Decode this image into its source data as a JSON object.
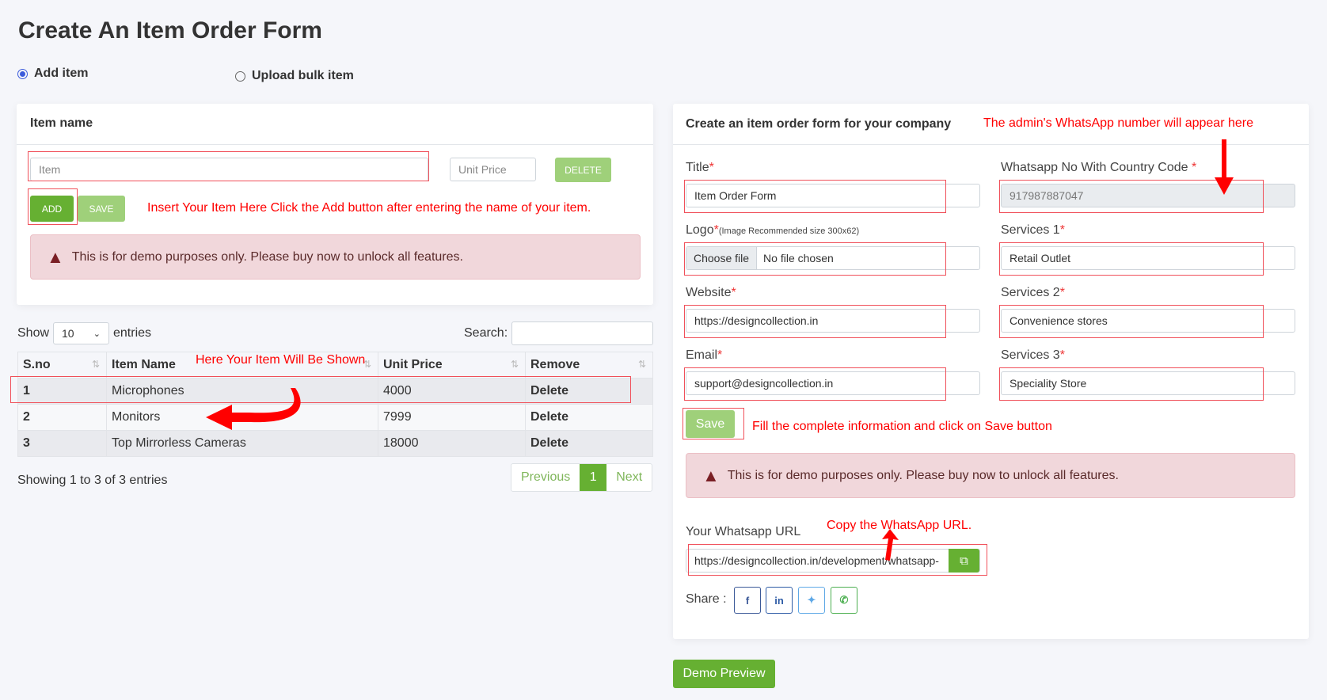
{
  "page": {
    "title": "Create An Item Order Form"
  },
  "mode": {
    "add_item": "Add item",
    "upload_bulk": "Upload bulk item",
    "selected": "add_item"
  },
  "item_card": {
    "header": "Item name",
    "item_placeholder": "Item",
    "price_placeholder": "Unit Price",
    "delete_label": "DELETE",
    "add_label": "ADD",
    "save_label": "SAVE",
    "annotation": "Insert Your Item Here Click the Add button after entering the name of your item.",
    "alert": "This is for demo purposes only. Please buy now to unlock all features."
  },
  "table": {
    "show_label": "Show",
    "entries_value": "10",
    "entries_label": "entries",
    "search_label": "Search:",
    "annotation": "Here Your Item Will Be Shown",
    "columns": [
      "S.no",
      "Item Name",
      "Unit Price",
      "Remove"
    ],
    "rows": [
      [
        "1",
        "Microphones",
        "4000",
        "Delete"
      ],
      [
        "2",
        "Monitors",
        "7999",
        "Delete"
      ],
      [
        "3",
        "Top Mirrorless Cameras",
        "18000",
        "Delete"
      ]
    ],
    "info": "Showing 1 to 3 of 3 entries",
    "prev": "Previous",
    "page": "1",
    "next": "Next"
  },
  "form_card": {
    "header": "Create an item order form for your company",
    "annotation_whatsapp": "The admin's WhatsApp number will appear here",
    "title_label": "Title",
    "title_value": "Item Order Form",
    "whatsapp_label": "Whatsapp No With Country Code",
    "whatsapp_value": "917987887047",
    "logo_label": "Logo",
    "logo_hint": "(Image Recommended size 300x62)",
    "choose_file": "Choose file",
    "no_file": "No file chosen",
    "services1_label": "Services 1",
    "services1_value": "Retail Outlet",
    "website_label": "Website",
    "website_value": "https://designcollection.in",
    "services2_label": "Services 2",
    "services2_value": "Convenience stores",
    "email_label": "Email",
    "email_value": "support@designcollection.in",
    "services3_label": "Services 3",
    "services3_value": "Speciality Store",
    "required": "*",
    "save_label": "Save",
    "annotation_save": "Fill the complete information and click on Save button",
    "alert": "This is for demo purposes only. Please buy now to unlock all features.",
    "url_label": "Your Whatsapp URL",
    "annotation_copy": "Copy the WhatsApp URL.",
    "url_value": "https://designcollection.in/development/whatsapp-",
    "share_label": "Share :"
  },
  "demo_preview": "Demo Preview",
  "colors": {
    "primary_green": "#66b032",
    "light_green": "#9fd07a",
    "annotation_red": "#ff0000",
    "alert_bg": "#f1d7db"
  }
}
